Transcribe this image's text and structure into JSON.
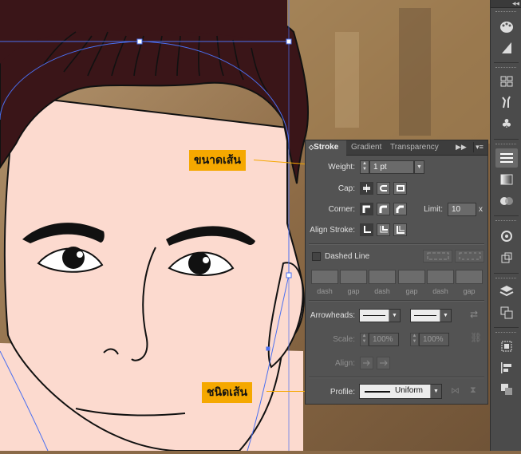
{
  "annotations": {
    "weight_callout": "ขนาดเส้น",
    "profile_callout": "ชนิดเส้น",
    "color": "#f5a800"
  },
  "panel": {
    "tabs": [
      {
        "label": "Stroke",
        "active": true
      },
      {
        "label": "Gradient",
        "active": false
      },
      {
        "label": "Transparency",
        "active": false
      }
    ],
    "weight": {
      "label": "Weight:",
      "value": "1 pt"
    },
    "cap": {
      "label": "Cap:",
      "selected": "butt"
    },
    "corner": {
      "label": "Corner:",
      "selected": "miter"
    },
    "limit": {
      "label": "Limit:",
      "value": "10",
      "suffix": "x"
    },
    "align_stroke": {
      "label": "Align Stroke:",
      "selected": "center"
    },
    "dashed_line": {
      "label": "Dashed Line",
      "checked": false
    },
    "dash_gap_labels": [
      "dash",
      "gap",
      "dash",
      "gap",
      "dash",
      "gap"
    ],
    "arrowheads": {
      "label": "Arrowheads:"
    },
    "scale": {
      "label": "Scale:",
      "start": "100%",
      "end": "100%"
    },
    "align": {
      "label": "Align:"
    },
    "profile": {
      "label": "Profile:",
      "value": "Uniform"
    }
  },
  "toolstrip": {
    "tools": [
      "swatches-icon",
      "brushes-icon",
      "symbols-icon",
      "graphic-styles-icon",
      "stroke-panel-icon",
      "gradient-icon",
      "transparency-icon",
      "appearance-icon",
      "transform-icon",
      "layers-icon",
      "artboards-icon",
      "align-icon",
      "pathfinder-icon",
      "navigator-icon"
    ]
  },
  "colors": {
    "hair": "#3a1518",
    "skin": "#fcdacf",
    "selection": "#4a6ff0",
    "panel_bg": "#535353"
  }
}
